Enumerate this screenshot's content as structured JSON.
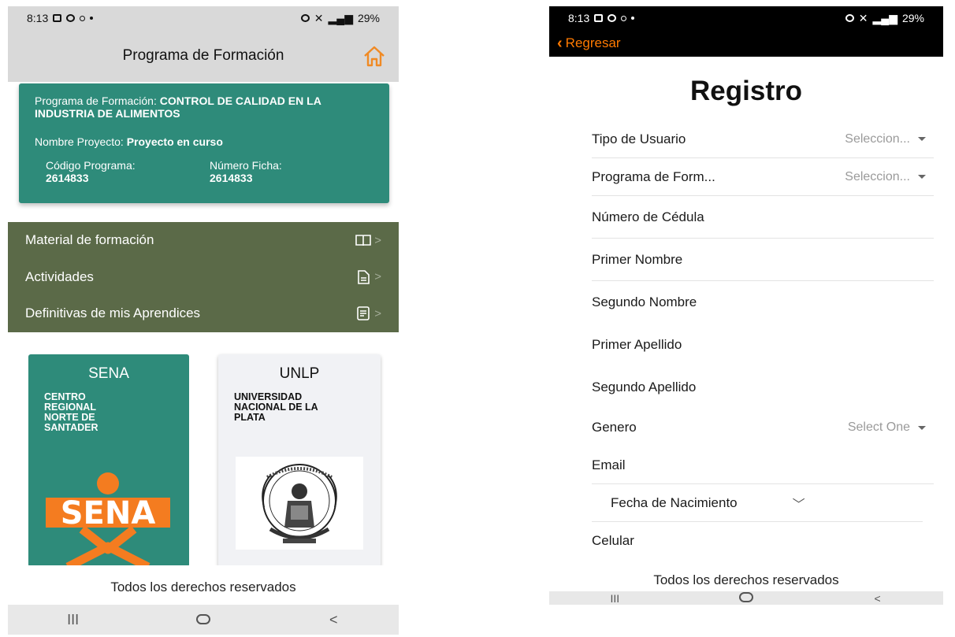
{
  "left": {
    "status": {
      "time": "8:13",
      "battery": "29%"
    },
    "header": {
      "title": "Programa de Formación"
    },
    "program_card": {
      "program_label": "Programa de Formación:",
      "program_value": "CONTROL DE CALIDAD EN LA INDUSTRIA DE ALIMENTOS",
      "project_label": "Nombre Proyecto:",
      "project_value": "Proyecto en curso",
      "code_label": "Código Programa:",
      "code_value": "2614833",
      "ficha_label": "Número Ficha:",
      "ficha_value": "2614833"
    },
    "menu": [
      {
        "label": "Material de formación",
        "icon": "book-icon"
      },
      {
        "label": "Actividades",
        "icon": "document-icon"
      },
      {
        "label": "Definitivas de mis Aprendices",
        "icon": "list-document-icon"
      }
    ],
    "institutions": [
      {
        "abbr": "SENA",
        "name": "CENTRO\nREGIONAL\nNORTE DE\nSANTADER",
        "logo_text": "SENA"
      },
      {
        "abbr": "UNLP",
        "name": "UNIVERSIDAD\nNACIONAL DE LA\nPLATA"
      }
    ],
    "footer": "Todos los derechos reservados"
  },
  "right": {
    "status": {
      "time": "8:13",
      "battery": "29%"
    },
    "back_label": "Regresar",
    "title": "Registro",
    "fields": {
      "tipo_usuario": {
        "label": "Tipo de Usuario",
        "placeholder": "Seleccion..."
      },
      "programa": {
        "label": "Programa de Form...",
        "placeholder": "Seleccion..."
      },
      "cedula": "Número de Cédula",
      "primer_nombre": "Primer Nombre",
      "segundo_nombre": "Segundo Nombre",
      "primer_apellido": "Primer Apellido",
      "segundo_apellido": "Segundo Apellido",
      "genero": {
        "label": "Genero",
        "placeholder": "Select One"
      },
      "email": "Email",
      "fecha": "Fecha de Nacimiento",
      "celular": "Celular"
    },
    "footer": "Todos los derechos reservados"
  },
  "colors": {
    "teal": "#2e8b7a",
    "olive": "#5b6a48",
    "orange": "#ff7a00",
    "header_gray": "#d9d9d9"
  }
}
